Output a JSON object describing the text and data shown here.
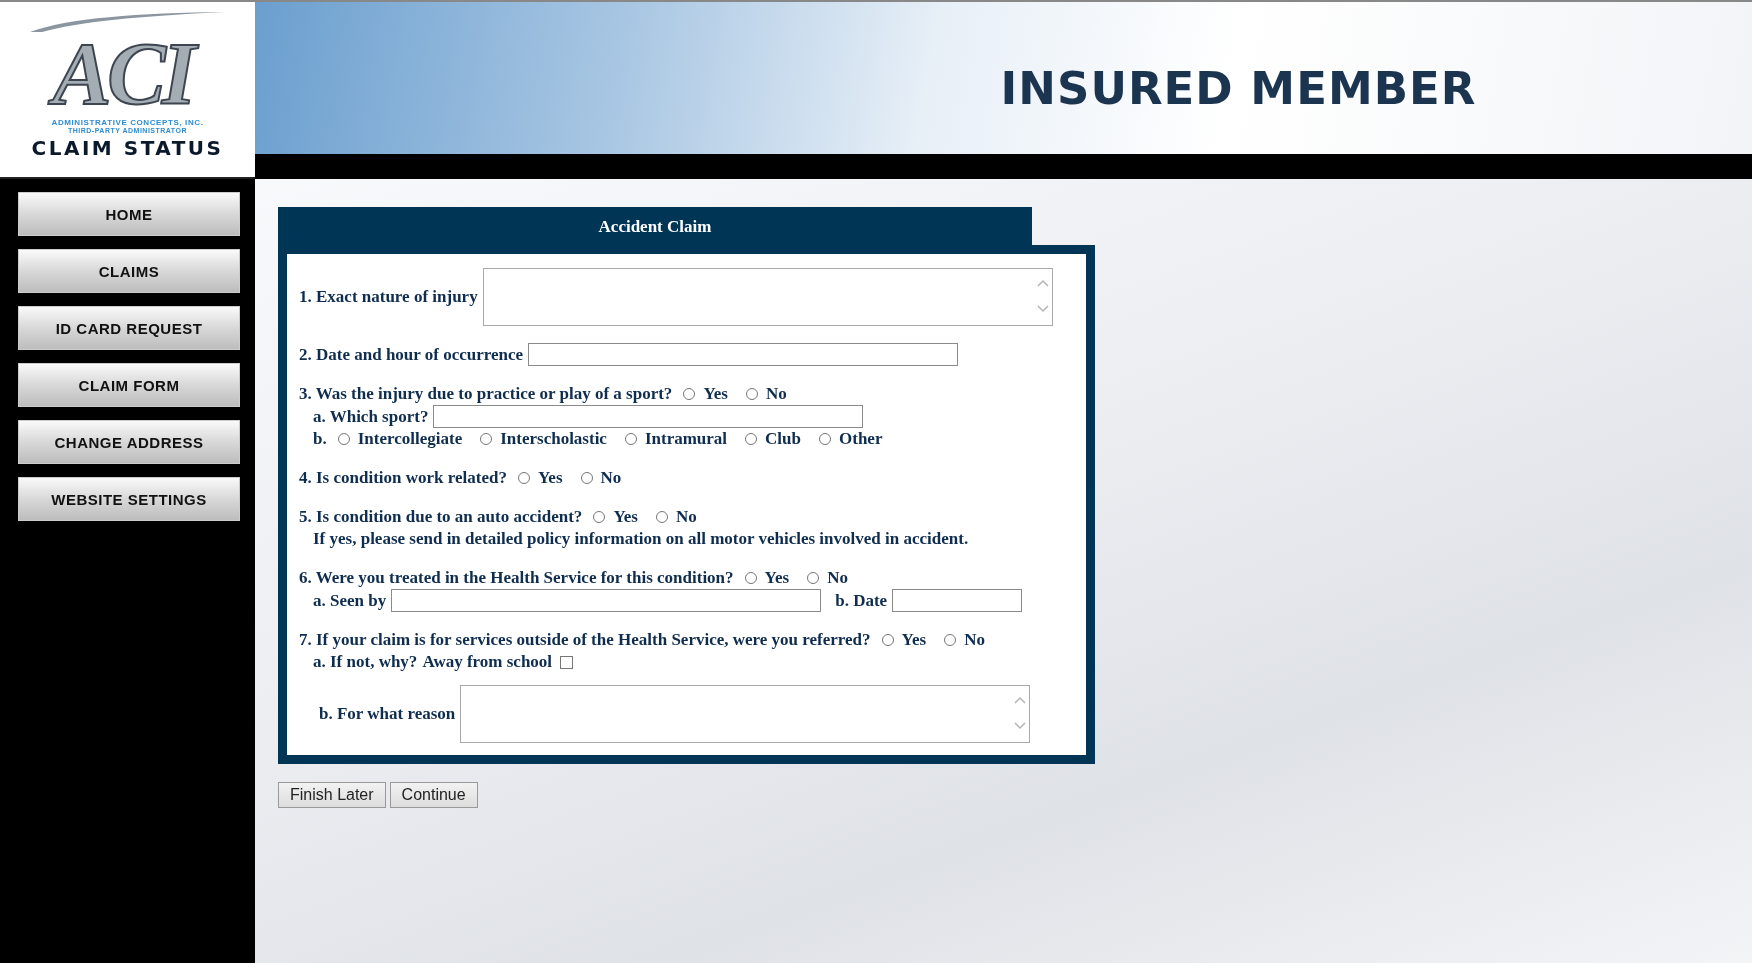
{
  "logo": {
    "letters": "ACI",
    "company": "ADMINISTRATIVE CONCEPTS, INC.",
    "tagline": "THIRD-PARTY ADMINISTRATOR",
    "product": "CLAIM STATUS"
  },
  "banner": {
    "title": "INSURED MEMBER"
  },
  "nav": [
    {
      "label": "HOME"
    },
    {
      "label": "CLAIMS"
    },
    {
      "label": "ID CARD REQUEST"
    },
    {
      "label": "CLAIM FORM"
    },
    {
      "label": "CHANGE ADDRESS"
    },
    {
      "label": "WEBSITE SETTINGS"
    }
  ],
  "form": {
    "title": "Accident Claim",
    "sections": [
      {
        "rows": [
          {
            "kind": "main",
            "items": [
              {
                "kind": "label",
                "text": "1. Exact nature of injury"
              },
              {
                "kind": "text-area"
              }
            ]
          }
        ]
      },
      {
        "rows": [
          {
            "kind": "main",
            "items": [
              {
                "kind": "label",
                "text": "2. Date and hour of occurrence"
              },
              {
                "kind": "input"
              }
            ]
          }
        ]
      },
      {
        "rows": [
          {
            "kind": "main",
            "items": [
              {
                "kind": "label",
                "text": "3. Was the injury due to practice or play of a sport?"
              },
              {
                "kind": "radio",
                "label": "Yes",
                "selected": false
              },
              {
                "kind": "radio",
                "label": "No",
                "selected": false
              }
            ]
          },
          {
            "kind": "sub",
            "items": [
              {
                "kind": "label",
                "text": "a. Which sport?"
              },
              {
                "kind": "input"
              }
            ]
          },
          {
            "kind": "sub",
            "items": [
              {
                "kind": "label",
                "text": "b."
              },
              {
                "kind": "radio",
                "label": "Intercollegiate",
                "selected": false
              },
              {
                "kind": "radio",
                "label": "Interscholastic",
                "selected": false
              },
              {
                "kind": "radio",
                "label": "Intramural",
                "selected": false
              },
              {
                "kind": "radio",
                "label": "Club",
                "selected": false
              },
              {
                "kind": "radio",
                "label": "Other",
                "selected": false
              }
            ]
          }
        ]
      },
      {
        "rows": [
          {
            "kind": "main",
            "items": [
              {
                "kind": "label",
                "text": "4. Is condition work related?"
              },
              {
                "kind": "radio",
                "label": "Yes",
                "selected": false
              },
              {
                "kind": "radio",
                "label": "No",
                "selected": false
              }
            ]
          }
        ]
      },
      {
        "rows": [
          {
            "kind": "main",
            "items": [
              {
                "kind": "label",
                "text": "5. Is condition due to an auto accident?"
              },
              {
                "kind": "radio",
                "label": "Yes",
                "selected": false
              },
              {
                "kind": "radio",
                "label": "No",
                "selected": false
              }
            ]
          },
          {
            "kind": "note",
            "items": [
              {
                "kind": "label",
                "text": "If yes, please send in detailed policy information on all motor vehicles involved in accident."
              }
            ]
          }
        ]
      },
      {
        "rows": [
          {
            "kind": "main",
            "items": [
              {
                "kind": "label",
                "text": "6. Were you treated in the Health Service for this condition?"
              },
              {
                "kind": "radio",
                "label": "Yes",
                "selected": false
              },
              {
                "kind": "radio",
                "label": "No",
                "selected": false
              }
            ]
          },
          {
            "kind": "sub",
            "items": [
              {
                "kind": "label",
                "text": "a. Seen by"
              },
              {
                "kind": "input"
              },
              {
                "kind": "label",
                "text": "b. Date"
              },
              {
                "kind": "short-input"
              }
            ]
          }
        ]
      },
      {
        "rows": [
          {
            "kind": "main",
            "items": [
              {
                "kind": "label",
                "text": "7. If your claim is for services outside of the Health Service, were you referred?"
              },
              {
                "kind": "radio",
                "label": "Yes",
                "selected": false
              },
              {
                "kind": "radio",
                "label": "No",
                "selected": false
              }
            ]
          },
          {
            "kind": "sub",
            "items": [
              {
                "kind": "label",
                "text": "a. If not, why?"
              },
              {
                "kind": "checkbox",
                "label": "Away from school",
                "checked": false
              }
            ]
          },
          {
            "kind": "sub-area",
            "items": [
              {
                "kind": "label",
                "text": "b. For what reason"
              },
              {
                "kind": "text-area"
              }
            ]
          }
        ]
      }
    ]
  },
  "buttons": [
    {
      "label": "Finish Later"
    },
    {
      "label": "Continue"
    }
  ]
}
